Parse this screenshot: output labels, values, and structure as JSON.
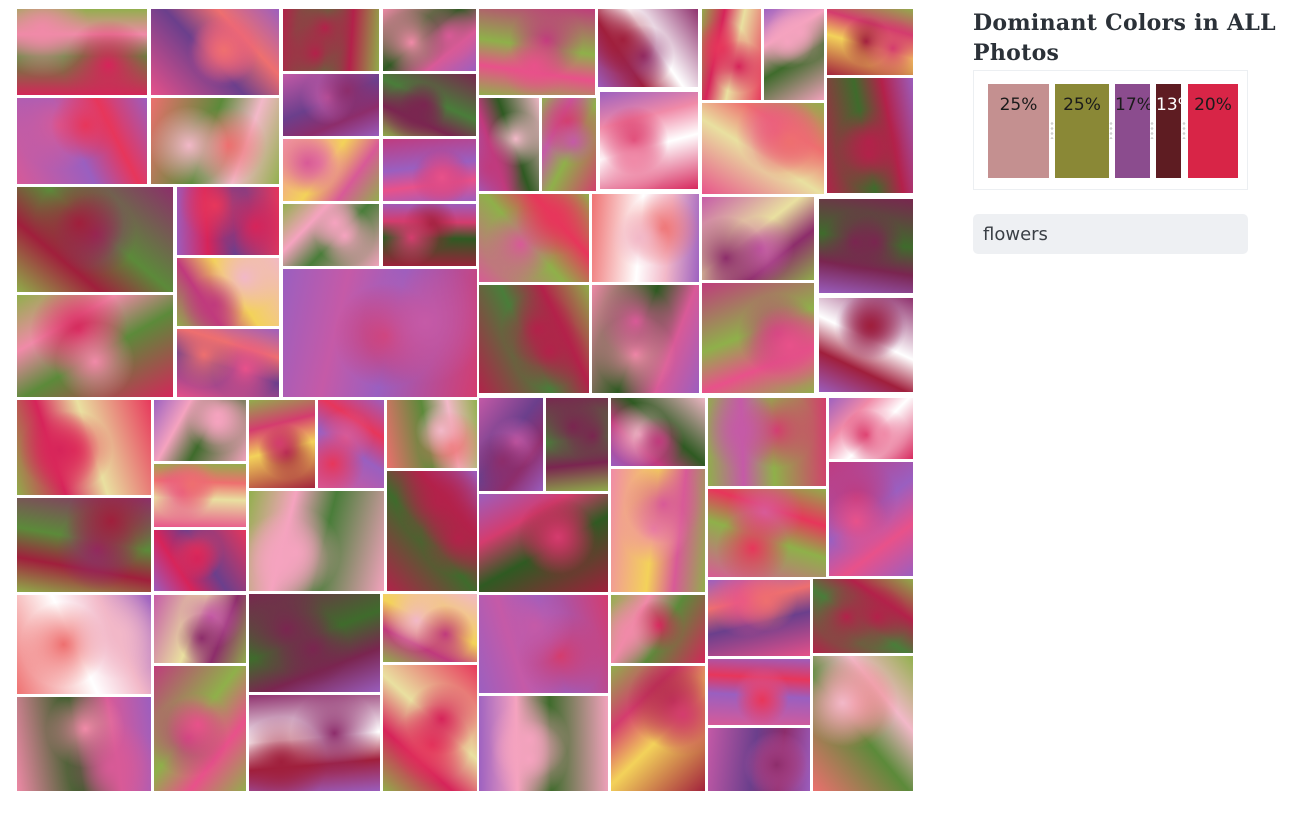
{
  "panel": {
    "title": "Dominant Colors in ALL Photos"
  },
  "palette": [
    {
      "percent_label": "25%",
      "color": "#c49090",
      "text_color": "#1b1b1b"
    },
    {
      "percent_label": "25%",
      "color": "#8a8836",
      "text_color": "#1b1b1b"
    },
    {
      "percent_label": "17%",
      "color": "#8b4c8e",
      "text_color": "#1b1b1b"
    },
    {
      "percent_label": "13%",
      "color": "#5e1c22",
      "text_color": "#ffffff"
    },
    {
      "percent_label": "20%",
      "color": "#d82547",
      "text_color": "#1b1b1b"
    }
  ],
  "search": {
    "value": "flowers"
  },
  "photos": {
    "count": 70,
    "subject": "flowers"
  }
}
